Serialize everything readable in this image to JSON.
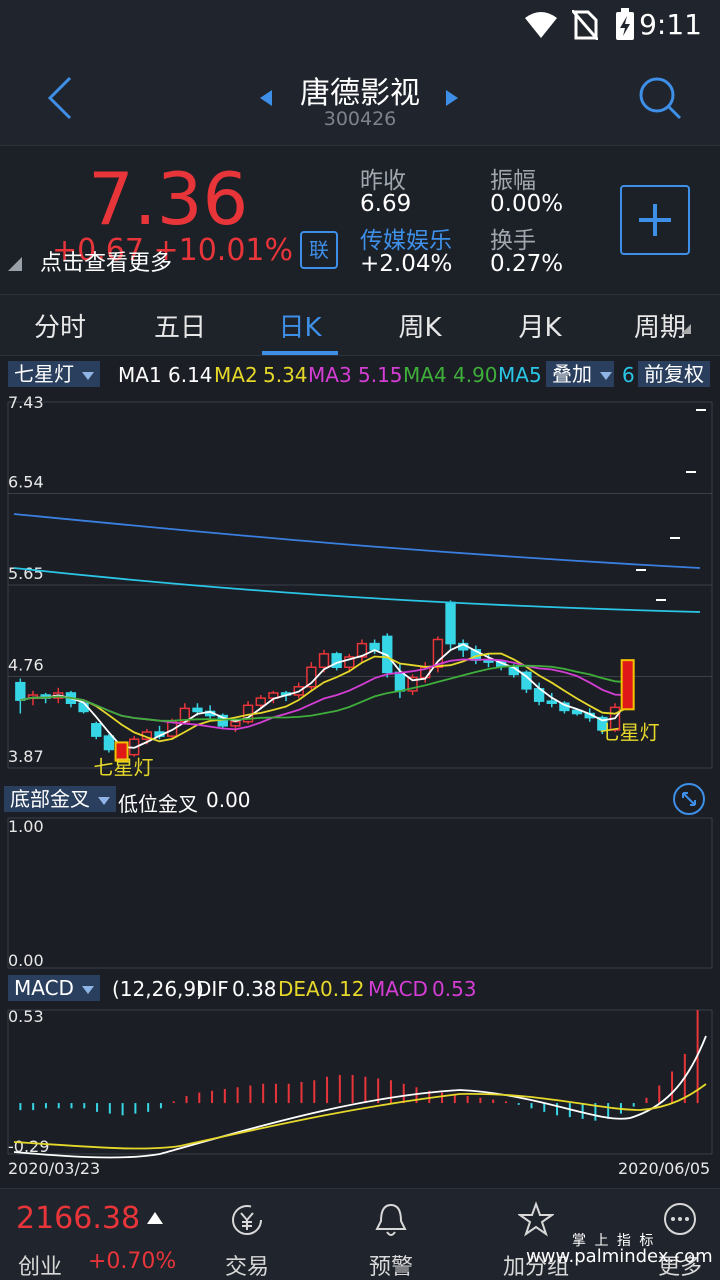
{
  "status": {
    "time": "9:11"
  },
  "header": {
    "title": "唐德影视",
    "code": "300426"
  },
  "quote": {
    "price": "7.36",
    "change": "+0.67  +10.01%",
    "see_more": "点击查看更多",
    "lian": "联",
    "prev_close_label": "昨收",
    "prev_close": "6.69",
    "amplitude_label": "振幅",
    "amplitude": "0.00%",
    "sector_label": "传媒娱乐",
    "sector_change": "+2.04%",
    "turnover_label": "换手",
    "turnover": "0.27%"
  },
  "tabs": [
    "分时",
    "五日",
    "日K",
    "周K",
    "月K",
    "周期"
  ],
  "main_indicator": {
    "dropdown": "七星灯",
    "ma1_label": "MA1",
    "ma1": "6.14",
    "ma2_label": "MA2",
    "ma2": "5.34",
    "ma3_label": "MA3",
    "ma3": "5.15",
    "ma4_label": "MA4",
    "ma4": "4.90",
    "ma5_label": "MA5",
    "overlay": "叠加",
    "overlay_suffix": "6",
    "adjust": "前复权",
    "colors": {
      "ma1": "#ffffff",
      "ma2": "#e6d82a",
      "ma3": "#d43ed4",
      "ma4": "#3fae3a",
      "ma5": "#2bc6e6",
      "up": "#e8353a",
      "down": "#37d6e6"
    }
  },
  "sub1": {
    "dropdown": "底部金叉",
    "label": "低位金叉",
    "value": "0.00",
    "ymax": "1.00",
    "ymin": "0.00"
  },
  "sub2": {
    "dropdown": "MACD",
    "params": "(12,26,9)",
    "dif_label": "DIF",
    "dif": "0.38",
    "dea_label": "DEA",
    "dea": "0.12",
    "macd_label": "MACD",
    "macd": "0.53",
    "ymax": "0.53",
    "ymin": "-0.29",
    "date_start": "2020/03/23",
    "date_end": "2020/06/05"
  },
  "bottom": {
    "index_value": "2166.38",
    "index_name": "创业",
    "index_change": "+0.70%",
    "nav": [
      "交易",
      "预警",
      "加分组",
      "更多"
    ],
    "watermark_top": "掌 上 指 标",
    "watermark": "www.palmindex.com"
  },
  "chart_data": {
    "type": "candlestick",
    "y_ticks": [
      "7.43",
      "6.54",
      "5.65",
      "4.76",
      "3.87"
    ],
    "ylim": [
      3.87,
      7.43
    ],
    "x_range": [
      "2020/03/23",
      "2020/06/05"
    ],
    "signal_label": "七星灯",
    "candles": [
      [
        4.7,
        4.74,
        4.4,
        4.53
      ],
      [
        4.55,
        4.62,
        4.48,
        4.58
      ],
      [
        4.58,
        4.6,
        4.5,
        4.55
      ],
      [
        4.55,
        4.65,
        4.5,
        4.6
      ],
      [
        4.6,
        4.62,
        4.46,
        4.5
      ],
      [
        4.5,
        4.52,
        4.4,
        4.42
      ],
      [
        4.3,
        4.32,
        4.15,
        4.18
      ],
      [
        4.18,
        4.2,
        4.02,
        4.05
      ],
      [
        4.05,
        4.08,
        3.98,
        4.0
      ],
      [
        4.0,
        4.18,
        3.98,
        4.15
      ],
      [
        4.15,
        4.25,
        4.1,
        4.22
      ],
      [
        4.22,
        4.28,
        4.15,
        4.18
      ],
      [
        4.18,
        4.35,
        4.15,
        4.32
      ],
      [
        4.32,
        4.5,
        4.3,
        4.45
      ],
      [
        4.45,
        4.5,
        4.38,
        4.42
      ],
      [
        4.42,
        4.48,
        4.35,
        4.38
      ],
      [
        4.38,
        4.4,
        4.25,
        4.28
      ],
      [
        4.28,
        4.35,
        4.22,
        4.32
      ],
      [
        4.32,
        4.52,
        4.3,
        4.48
      ],
      [
        4.48,
        4.58,
        4.45,
        4.55
      ],
      [
        4.55,
        4.62,
        4.5,
        4.6
      ],
      [
        4.6,
        4.62,
        4.52,
        4.58
      ],
      [
        4.58,
        4.7,
        4.55,
        4.66
      ],
      [
        4.66,
        4.9,
        4.62,
        4.85
      ],
      [
        4.85,
        5.02,
        4.8,
        4.98
      ],
      [
        4.98,
        5.0,
        4.82,
        4.85
      ],
      [
        4.85,
        4.98,
        4.8,
        4.95
      ],
      [
        4.95,
        5.12,
        4.9,
        5.08
      ],
      [
        5.08,
        5.12,
        4.98,
        5.02
      ],
      [
        5.15,
        5.18,
        4.75,
        4.8
      ],
      [
        4.8,
        4.88,
        4.55,
        4.62
      ],
      [
        4.62,
        4.78,
        4.58,
        4.75
      ],
      [
        4.75,
        4.9,
        4.7,
        4.85
      ],
      [
        4.85,
        5.15,
        4.8,
        5.12
      ],
      [
        5.48,
        5.5,
        5.02,
        5.08
      ],
      [
        5.08,
        5.12,
        4.95,
        5.02
      ],
      [
        5.02,
        5.06,
        4.88,
        4.92
      ],
      [
        4.92,
        4.98,
        4.85,
        4.9
      ],
      [
        4.9,
        4.92,
        4.82,
        4.86
      ],
      [
        4.86,
        4.88,
        4.75,
        4.78
      ],
      [
        4.8,
        4.82,
        4.6,
        4.64
      ],
      [
        4.64,
        4.7,
        4.48,
        4.52
      ],
      [
        4.52,
        4.6,
        4.46,
        4.5
      ],
      [
        4.5,
        4.52,
        4.4,
        4.43
      ],
      [
        4.43,
        4.45,
        4.38,
        4.4
      ],
      [
        4.4,
        4.45,
        4.32,
        4.36
      ],
      [
        4.36,
        4.38,
        4.2,
        4.24
      ],
      [
        4.24,
        4.5,
        4.22,
        4.46
      ],
      [
        4.5,
        4.88,
        4.48,
        4.85
      ]
    ],
    "macd_hist": [
      -0.04,
      -0.04,
      -0.03,
      -0.03,
      -0.03,
      -0.03,
      -0.05,
      -0.06,
      -0.07,
      -0.06,
      -0.05,
      -0.03,
      0.01,
      0.04,
      0.06,
      0.07,
      0.08,
      0.09,
      0.1,
      0.11,
      0.11,
      0.11,
      0.12,
      0.13,
      0.15,
      0.16,
      0.16,
      0.15,
      0.14,
      0.13,
      0.11,
      0.09,
      0.07,
      0.06,
      0.05,
      0.04,
      0.03,
      0.02,
      0.01,
      -0.01,
      -0.03,
      -0.05,
      -0.07,
      -0.08,
      -0.09,
      -0.1,
      -0.09,
      -0.06,
      -0.02,
      0.03,
      0.1,
      0.18,
      0.28,
      0.53
    ]
  }
}
